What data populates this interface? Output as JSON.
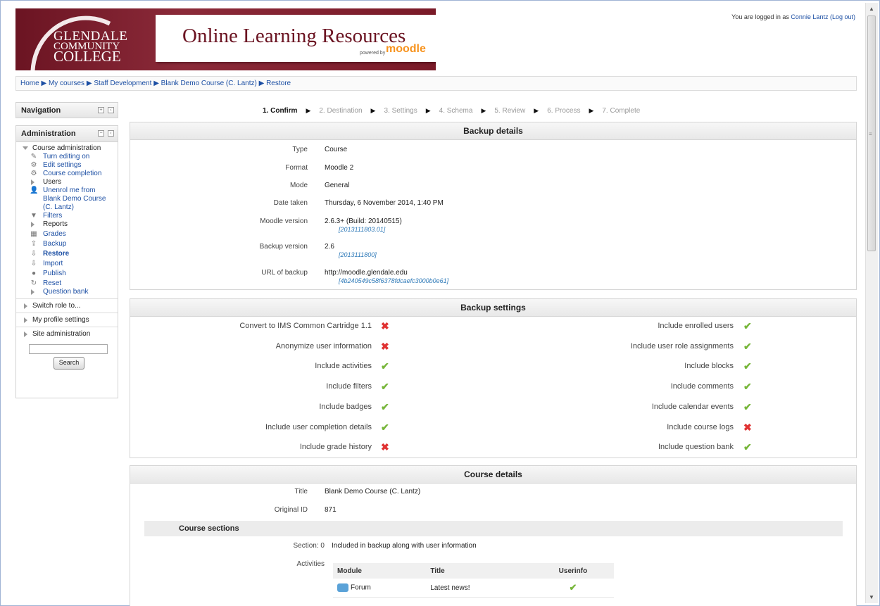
{
  "header": {
    "college_l1": "GLENDALE",
    "college_l2": "COMMUNITY",
    "college_l3": "COLLEGE",
    "site_title": "Online Learning Resources",
    "powered_by": "powered by",
    "moodle": "moodle",
    "logged_in_text": "You are logged in as",
    "user_name": "Connie Lantz",
    "logout": "(Log out)"
  },
  "breadcrumb": [
    "Home",
    "My courses",
    "Staff Development",
    "Blank Demo Course (C. Lantz)",
    "Restore"
  ],
  "sidebar": {
    "navigation_title": "Navigation",
    "admin_title": "Administration",
    "course_admin": "Course administration",
    "items": [
      {
        "label": "Turn editing on",
        "icon": "pencil-icon"
      },
      {
        "label": "Edit settings",
        "icon": "gear-icon"
      },
      {
        "label": "Course completion",
        "icon": "gear-icon"
      },
      {
        "label": "Users",
        "icon": "expand-arrow"
      },
      {
        "label": "Unenrol me from Blank Demo Course (C. Lantz)",
        "icon": "user-icon"
      },
      {
        "label": "Filters",
        "icon": "filter-icon"
      },
      {
        "label": "Reports",
        "icon": "expand-arrow"
      },
      {
        "label": "Grades",
        "icon": "grades-icon"
      },
      {
        "label": "Backup",
        "icon": "backup-icon"
      },
      {
        "label": "Restore",
        "icon": "restore-icon"
      },
      {
        "label": "Import",
        "icon": "import-icon"
      },
      {
        "label": "Publish",
        "icon": "publish-icon"
      },
      {
        "label": "Reset",
        "icon": "reset-icon"
      },
      {
        "label": "Question bank",
        "icon": "expand-arrow"
      }
    ],
    "switch_role": "Switch role to...",
    "profile_settings": "My profile settings",
    "site_admin": "Site administration",
    "search_button": "Search"
  },
  "steps": [
    "1. Confirm",
    "2. Destination",
    "3. Settings",
    "4. Schema",
    "5. Review",
    "6. Process",
    "7. Complete"
  ],
  "backup_details": {
    "title": "Backup details",
    "type_label": "Type",
    "type": "Course",
    "format_label": "Format",
    "format": "Moodle 2",
    "mode_label": "Mode",
    "mode": "General",
    "date_label": "Date taken",
    "date": "Thursday, 6 November 2014, 1:40 PM",
    "moodle_version_label": "Moodle version",
    "moodle_version": "2.6.3+ (Build: 20140515)",
    "moodle_version_id": "[2013111803.01]",
    "backup_version_label": "Backup version",
    "backup_version": "2.6",
    "backup_version_id": "[2013111800]",
    "url_label": "URL of backup",
    "url": "http://moodle.glendale.edu",
    "url_hash": "[4b240549c58f6378fdcaefc3000b0e61]"
  },
  "backup_settings": {
    "title": "Backup settings",
    "left": [
      {
        "label": "Convert to IMS Common Cartridge 1.1",
        "value": false
      },
      {
        "label": "Anonymize user information",
        "value": false
      },
      {
        "label": "Include activities",
        "value": true
      },
      {
        "label": "Include filters",
        "value": true
      },
      {
        "label": "Include badges",
        "value": true
      },
      {
        "label": "Include user completion details",
        "value": true
      },
      {
        "label": "Include grade history",
        "value": false
      }
    ],
    "right": [
      {
        "label": "Include enrolled users",
        "value": true
      },
      {
        "label": "Include user role assignments",
        "value": true
      },
      {
        "label": "Include blocks",
        "value": true
      },
      {
        "label": "Include comments",
        "value": true
      },
      {
        "label": "Include calendar events",
        "value": true
      },
      {
        "label": "Include course logs",
        "value": false
      },
      {
        "label": "Include question bank",
        "value": true
      }
    ]
  },
  "course_details": {
    "title": "Course details",
    "title_label": "Title",
    "course_title": "Blank Demo Course (C. Lantz)",
    "original_id_label": "Original ID",
    "original_id": "871",
    "sections_title": "Course sections",
    "section_label": "Section: 0",
    "section_text": "Included in backup along with user information",
    "activities_label": "Activities",
    "table_headers": [
      "Module",
      "Title",
      "Userinfo"
    ],
    "rows": [
      {
        "module": "Forum",
        "title": "Latest news!",
        "userinfo": true
      }
    ]
  },
  "marks": {
    "check": "✔",
    "cross": "✖"
  },
  "colors": {
    "check": "#77b63a",
    "cross": "#e03333",
    "banner": "#7a1c2b",
    "link": "#1b4ea3"
  }
}
